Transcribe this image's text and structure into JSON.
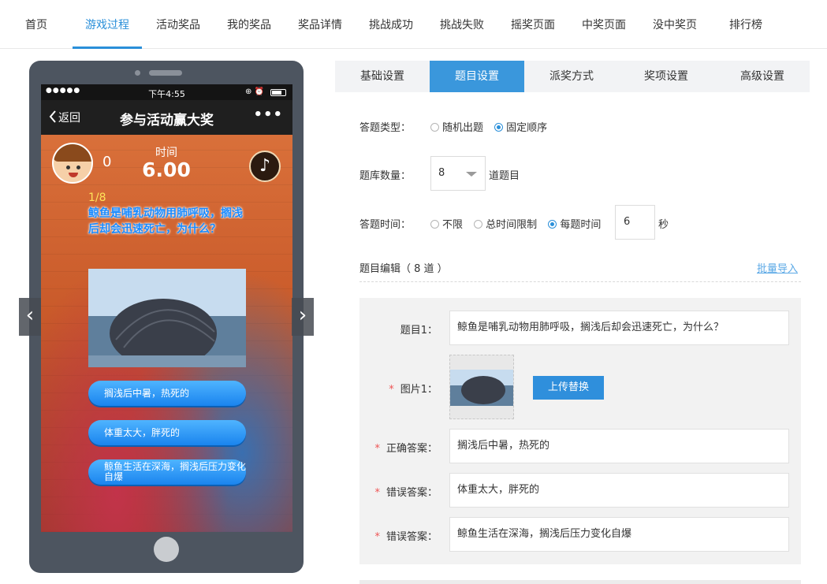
{
  "top_tabs": [
    "首页",
    "游戏过程",
    "活动奖品",
    "我的奖品",
    "奖品详情",
    "挑战成功",
    "挑战失败",
    "摇奖页面",
    "中奖页面",
    "没中奖页",
    "排行榜"
  ],
  "active_top_tab": "游戏过程",
  "phone": {
    "status_signal": "●●●●●",
    "status_time": "下午4:55",
    "status_icons": "⊕ ⏰",
    "back_label": "返回",
    "title": "参与活动赢大奖",
    "more_label": "•••",
    "score": "0",
    "time_label": "时间",
    "time_value": "6.00",
    "question_number": "1/8",
    "question_text": "鲸鱼是哺乳动物用肺呼吸，搁浅后却会迅速死亡，为什么？",
    "answers": [
      "搁浅后中暑，热死的",
      "体重太大，胖死的",
      "鲸鱼生活在深海，搁浅后压力变化自爆"
    ]
  },
  "sub_tabs": [
    "基础设置",
    "题目设置",
    "派奖方式",
    "奖项设置",
    "高级设置"
  ],
  "active_sub_tab": "题目设置",
  "form": {
    "type_label": "答题类型：",
    "type_options": [
      "随机出题",
      "固定顺序"
    ],
    "type_selected": "固定顺序",
    "count_label": "题库数量：",
    "count_value": "8",
    "count_suffix": "道题目",
    "time_label": "答题时间：",
    "time_options": [
      "不限",
      "总时间限制",
      "每题时间"
    ],
    "time_selected": "每题时间",
    "time_value": "6",
    "time_unit": "秒",
    "section_title": "题目编辑（ 8 道 ）",
    "batch_import": "批量导入",
    "question_label": "题目1：",
    "question_value": "鲸鱼是哺乳动物用肺呼吸，搁浅后却会迅速死亡，为什么？",
    "required_mark": "*",
    "image_label": "图片1：",
    "upload_label": "上传替换",
    "correct_label": "正确答案：",
    "correct_value": "搁浅后中暑，热死的",
    "wrong_label_1": "错误答案：",
    "wrong_value_1": "体重太大，胖死的",
    "wrong_label_2": "错误答案：",
    "wrong_value_2": "鲸鱼生活在深海，搁浅后压力变化自爆"
  },
  "colors": {
    "accent": "#2a8fd9",
    "subtab_active": "#3a97dc",
    "answer_button": "#1a84ee",
    "phone_body": "#4d5560"
  }
}
